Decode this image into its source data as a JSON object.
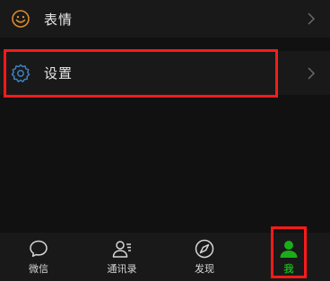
{
  "menu": {
    "items": [
      {
        "label": "表情",
        "icon": "sticker-smile-icon",
        "icon_color": "#d98b2b"
      },
      {
        "label": "设置",
        "icon": "gear-icon",
        "icon_color": "#3b82c4"
      }
    ]
  },
  "tabbar": {
    "tabs": [
      {
        "label": "微信",
        "icon": "chat-bubble-icon",
        "active": false
      },
      {
        "label": "通讯录",
        "icon": "contacts-icon",
        "active": false
      },
      {
        "label": "发现",
        "icon": "compass-icon",
        "active": false
      },
      {
        "label": "我",
        "icon": "person-icon",
        "active": true
      }
    ]
  },
  "colors": {
    "background": "#111111",
    "row_background": "#191919",
    "active_tab": "#1aad19",
    "highlight": "#ff1a1a"
  }
}
